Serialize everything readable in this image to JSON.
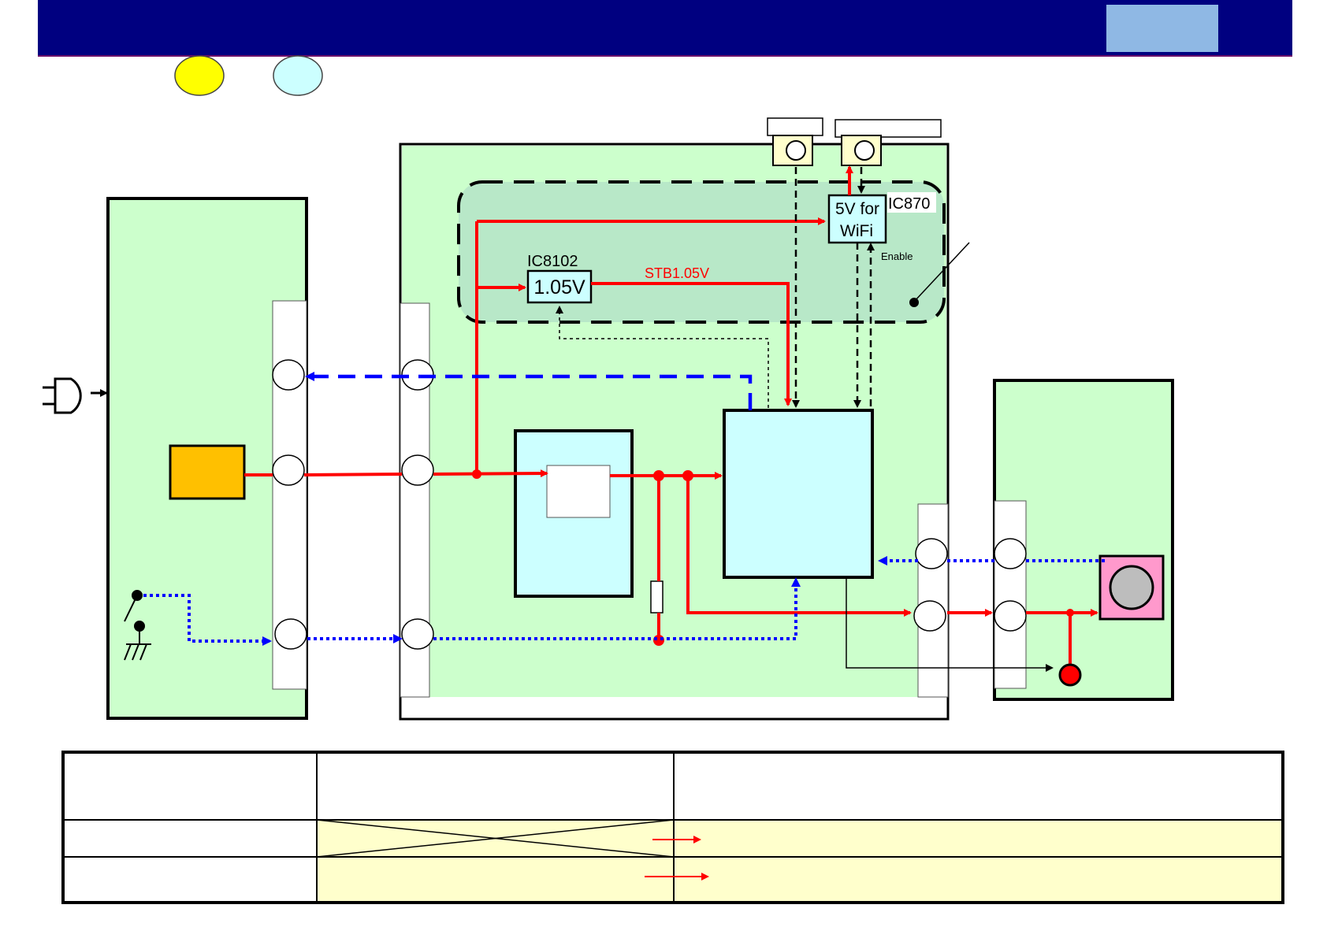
{
  "header": {
    "title": "",
    "badge": ""
  },
  "legend_circles": [
    {
      "name": "yellow",
      "color": "#ffff00"
    },
    {
      "name": "cyan",
      "color": "#ccffff"
    }
  ],
  "colors": {
    "board": "#ccffcc",
    "ic_box": "#ccffff",
    "power_line": "#ff0000",
    "signal_line_blue": "#0000ff",
    "orange_block": "#ffc000",
    "pink_block": "#ff99cc",
    "table_highlight": "#ffffcc"
  },
  "labels": {
    "ic8102_ref": "IC8102",
    "ic8102_value": "1.05V",
    "stb_rail": "STB1.05V",
    "ic870_ref": "IC870",
    "ic870_line1": "5V for",
    "ic870_line2": "WiFi",
    "enable": "Enable"
  },
  "icons": [
    "ac-plug-icon",
    "switch-icon",
    "ground-icon",
    "connector-circle-icon",
    "speaker-icon",
    "led-icon",
    "arrow-icon"
  ]
}
